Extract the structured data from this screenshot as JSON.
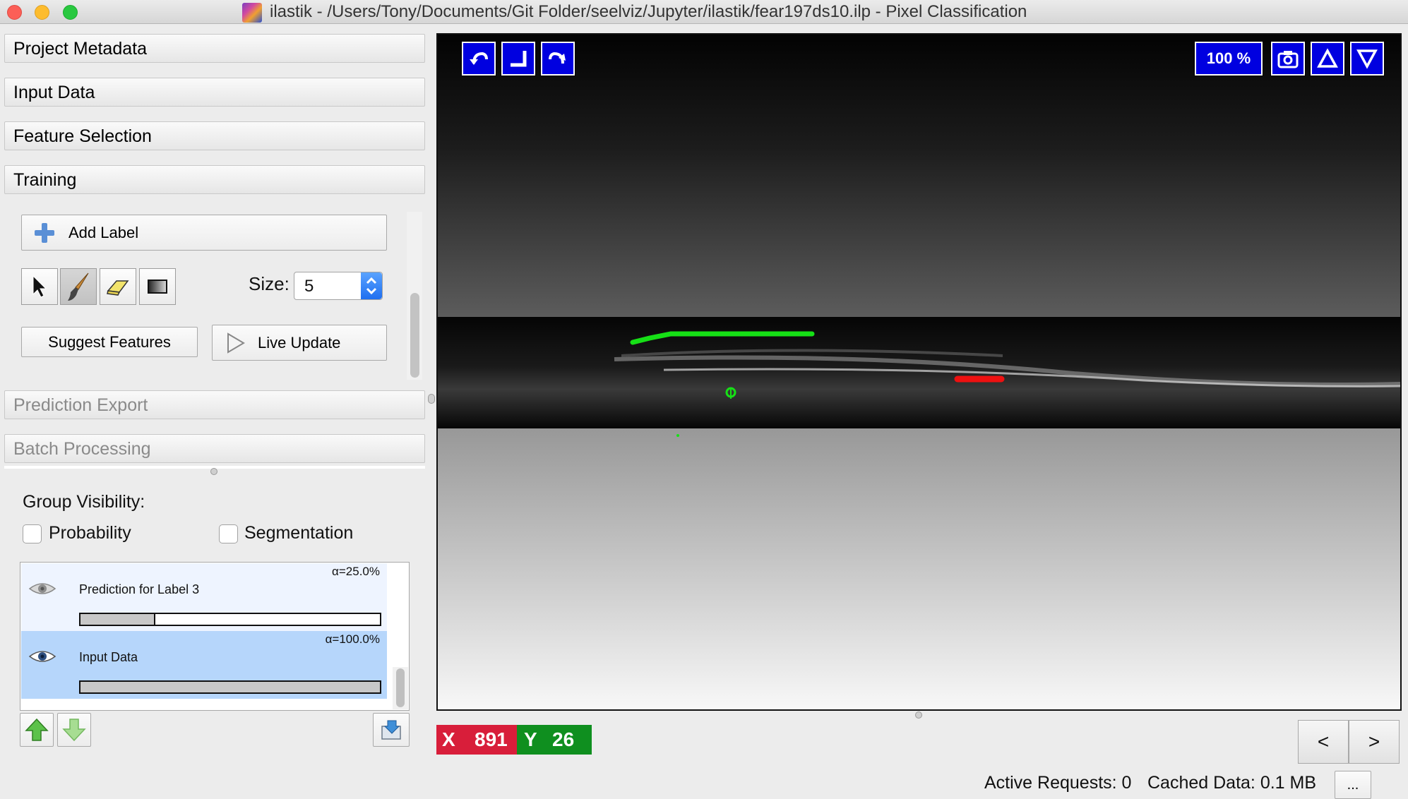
{
  "window": {
    "title": "ilastik - /Users/Tony/Documents/Git Folder/seelviz/Jupyter/ilastik/fear197ds10.ilp - Pixel Classification"
  },
  "applets": {
    "project_metadata": "Project Metadata",
    "input_data": "Input Data",
    "feature_selection": "Feature Selection",
    "training": "Training",
    "prediction_export": "Prediction Export",
    "batch_processing": "Batch Processing"
  },
  "training": {
    "add_label": "Add Label",
    "size_label": "Size:",
    "size_value": "5",
    "suggest_features": "Suggest Features",
    "live_update": "Live Update",
    "tools": [
      "pointer-tool",
      "brush-tool",
      "eraser-tool",
      "threshold-tool"
    ]
  },
  "group_visibility": {
    "title": "Group Visibility:",
    "probability": "Probability",
    "segmentation": "Segmentation",
    "probability_checked": false,
    "segmentation_checked": false
  },
  "layers": [
    {
      "name": "Prediction for Label 3",
      "opacity": "α=25.0%",
      "opacity_fraction": 0.25,
      "selected": false
    },
    {
      "name": "Input Data",
      "opacity": "α=100.0%",
      "opacity_fraction": 1.0,
      "selected": true
    }
  ],
  "viewer": {
    "zoom": "100 %",
    "labels": [
      {
        "name": "green-label-stroke",
        "color": "#16e016"
      },
      {
        "name": "red-label-stroke",
        "color": "#ee1010"
      }
    ]
  },
  "coords": {
    "x_label": "X",
    "x_value": "891",
    "y_label": "Y",
    "y_value": "26",
    "x_color": "#d81e3a",
    "y_color": "#0f8f1f"
  },
  "nav": {
    "prev": "<",
    "next": ">"
  },
  "status": {
    "active_requests": "Active Requests: 0",
    "cached_data": "Cached Data: 0.1 MB",
    "more": "..."
  }
}
